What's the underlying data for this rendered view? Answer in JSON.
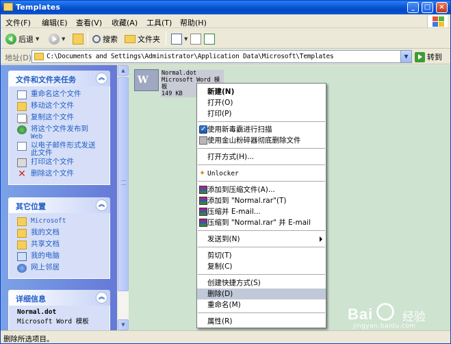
{
  "window": {
    "title": "Templates",
    "buttons": [
      "_",
      "□",
      "×"
    ]
  },
  "menubar": [
    "文件(F)",
    "编辑(E)",
    "查看(V)",
    "收藏(A)",
    "工具(T)",
    "帮助(H)"
  ],
  "toolbar": {
    "back": "后退",
    "search": "搜索",
    "folders": "文件夹"
  },
  "address": {
    "label": "地址(D)",
    "path": "C:\\Documents and Settings\\Administrator\\Application Data\\Microsoft\\Templates",
    "go": "转到"
  },
  "sidebar": {
    "tasks": {
      "title": "文件和文件夹任务",
      "items": [
        {
          "label": "重命名这个文件",
          "icon": "rename-icon"
        },
        {
          "label": "移动这个文件",
          "icon": "move-icon"
        },
        {
          "label": "复制这个文件",
          "icon": "copy-icon"
        },
        {
          "label": "将这个文件发布到",
          "label2": "Web",
          "icon": "publish-web-icon"
        },
        {
          "label": "以电子邮件形式发送",
          "label2": "此文件",
          "icon": "email-icon"
        },
        {
          "label": "打印这个文件",
          "icon": "print-icon"
        },
        {
          "label": "删除这个文件",
          "icon": "delete-icon"
        }
      ]
    },
    "places": {
      "title": "其它位置",
      "items": [
        {
          "label": "Microsoft",
          "icon": "folder-icon"
        },
        {
          "label": "我的文档",
          "icon": "folder-icon"
        },
        {
          "label": "共享文档",
          "icon": "folder-icon"
        },
        {
          "label": "我的电脑",
          "icon": "computer-icon"
        },
        {
          "label": "网上邻居",
          "icon": "network-icon"
        }
      ]
    },
    "details": {
      "title": "详细信息",
      "name": "Normal.dot",
      "type": "Microsoft Word 模板"
    }
  },
  "file": {
    "name": "Normal.dot",
    "type": "Microsoft Word 模板",
    "size": "149 KB"
  },
  "context_menu": {
    "items": [
      {
        "label": "新建(N)",
        "bold": true
      },
      {
        "label": "打开(O)"
      },
      {
        "label": "打印(P)"
      },
      {
        "label": "使用新毒霸进行扫描",
        "icon": "shield-icon"
      },
      {
        "label": "使用金山粉碎器彻底删除文件",
        "icon": "shredder-icon"
      },
      {
        "label": "打开方式(H)..."
      },
      {
        "label": "Unlocker",
        "icon": "unlocker-icon"
      },
      {
        "label": "添加到压缩文件(A)...",
        "icon": "winrar-icon"
      },
      {
        "label": "添加到 \"Normal.rar\"(T)",
        "icon": "winrar-icon"
      },
      {
        "label": "压缩并 E-mail...",
        "icon": "winrar-icon"
      },
      {
        "label": "压缩到 \"Normal.rar\" 并 E-mail",
        "icon": "winrar-icon"
      },
      {
        "label": "发送到(N)",
        "submenu": true
      },
      {
        "label": "剪切(T)"
      },
      {
        "label": "复制(C)"
      },
      {
        "label": "创建快捷方式(S)"
      },
      {
        "label": "删除(D)",
        "highlighted": true
      },
      {
        "label": "重命名(M)"
      },
      {
        "label": "属性(R)"
      }
    ]
  },
  "statusbar": {
    "text": "删除所选项目。"
  },
  "watermark": {
    "brand": "Bai",
    "suffix": "经验",
    "url": "jingyan.baidu.com"
  }
}
